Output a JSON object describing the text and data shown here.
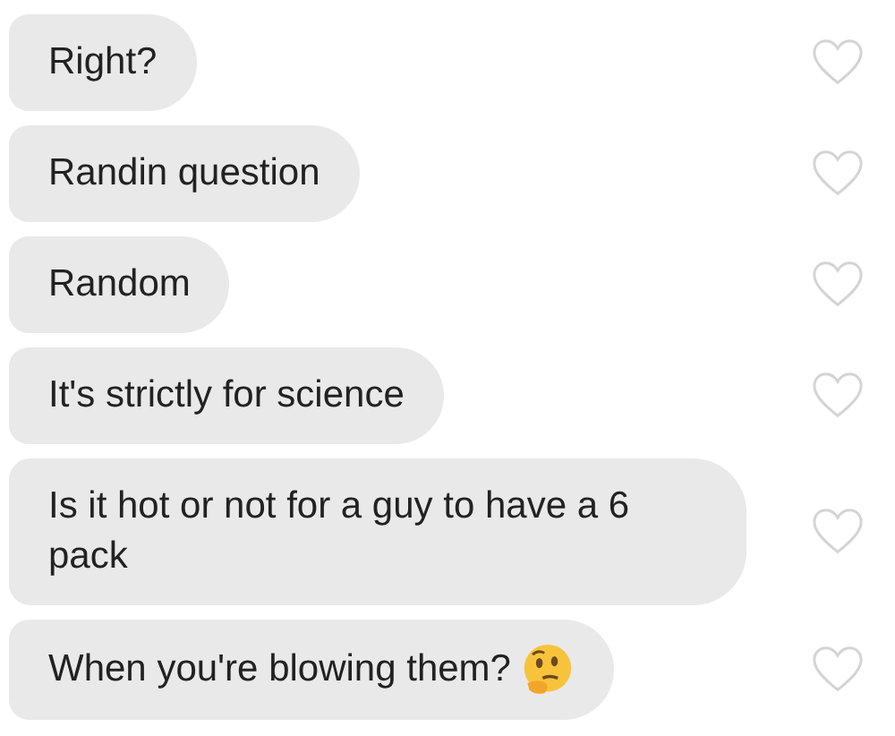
{
  "messages": [
    {
      "text": "Right?",
      "liked": false,
      "emoji": false
    },
    {
      "text": "Randin question",
      "liked": false,
      "emoji": false
    },
    {
      "text": "Random",
      "liked": false,
      "emoji": false
    },
    {
      "text": "It's strictly for science",
      "liked": false,
      "emoji": false
    },
    {
      "text": "Is it hot or not for a guy to have a 6 pack",
      "liked": false,
      "emoji": false
    },
    {
      "text": "When you're blowing them?",
      "liked": false,
      "emoji": true
    }
  ]
}
